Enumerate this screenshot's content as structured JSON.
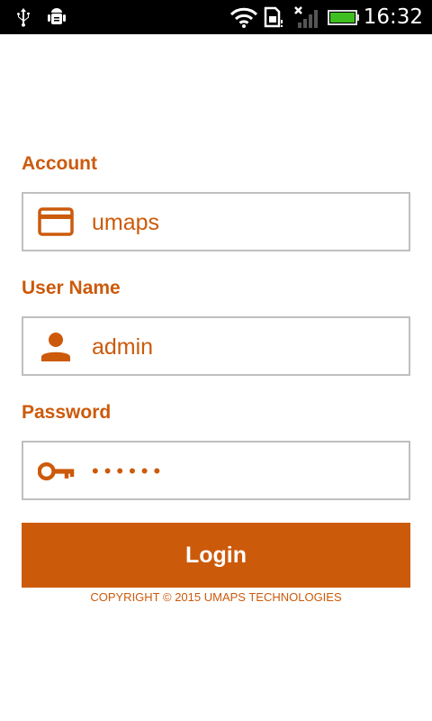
{
  "status_bar": {
    "time": "16:32",
    "icons": [
      "usb-icon",
      "android-debug-icon",
      "wifi-icon",
      "sim-icon",
      "signal-icon",
      "battery-icon"
    ]
  },
  "form": {
    "account": {
      "label": "Account",
      "value": "umaps",
      "icon": "card-icon"
    },
    "username": {
      "label": "User Name",
      "value": "admin",
      "icon": "person-icon"
    },
    "password": {
      "label": "Password",
      "value": "••••••",
      "icon": "key-icon"
    }
  },
  "login_button": {
    "label": "Login"
  },
  "footer": {
    "copyright": "COPYRIGHT © 2015 UMAPS TECHNOLOGIES"
  },
  "colors": {
    "accent": "#cc5a0b",
    "border": "#bfbfbf",
    "statusbar": "#000000"
  }
}
